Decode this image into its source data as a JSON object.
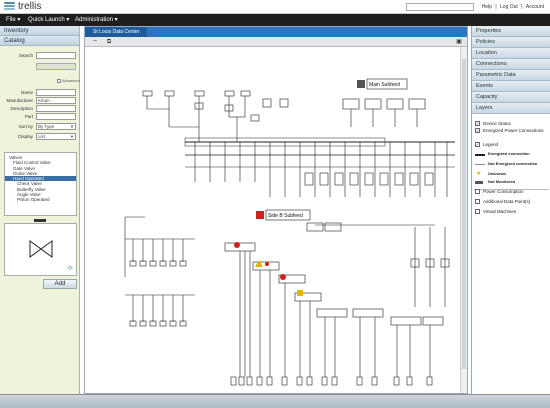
{
  "app": {
    "name": "trellis"
  },
  "header": {
    "links": [
      "Help",
      "|",
      "Log Out",
      "|",
      "Account"
    ]
  },
  "menu": {
    "items": [
      "File",
      "Quick Launch",
      "Administration"
    ]
  },
  "left": {
    "inventory_title": "Inventory",
    "catalog_title": "Catalog",
    "search_label": "Search",
    "advanced_label": "Advanced",
    "name_label": "Name",
    "manufacturer_label": "Manufacturer",
    "manufacturer_value": "Kirum",
    "description_label": "Description",
    "part_label": "Part",
    "sortby_label": "Sort by",
    "sortby_value": "By Type",
    "display_label": "Display",
    "display_value": "List",
    "list_items": [
      "Valves",
      "Fluid Control Valve",
      "Gate Valve",
      "Globe Valve",
      "Hand Operated",
      "Check Valve",
      "Butterfly Valve",
      "Angle Valve",
      "Piston Operated"
    ],
    "selected_index": 4,
    "add_label": "Add"
  },
  "center": {
    "tab_label": "St Louis Data Center",
    "main_subfeed": "Main Subfeed",
    "side_b_subfeed": "Side B Subfeed"
  },
  "right": {
    "sections": [
      "Properties",
      "Policies",
      "Location",
      "Connections",
      "Parametric Data",
      "Events",
      "Capacity",
      "Layers"
    ],
    "layers": [
      {
        "label": "Device Status",
        "checked": true
      },
      {
        "label": "Energized Power Connections",
        "checked": true
      },
      {
        "label": "Legend",
        "checked": true
      }
    ],
    "legend": [
      {
        "label": "Energized connection",
        "color": "#222222"
      },
      {
        "label": "Not Energized connection",
        "color": "#888888"
      },
      {
        "label": "Unknown",
        "color": "#e0b400"
      },
      {
        "label": "Not Monitored",
        "color": "#555555"
      }
    ],
    "other_layers": [
      {
        "label": "Power Consumption",
        "checked": false
      },
      {
        "label": "Additional Data Point(s)",
        "checked": false
      },
      {
        "label": "Virtual Machines",
        "checked": false
      }
    ]
  },
  "colors": {
    "menubar": "#1e1e1e",
    "tab": "#2d74c4",
    "selected": "#3a6fa6",
    "alarm": "#cc2222",
    "warning": "#e0b400"
  }
}
